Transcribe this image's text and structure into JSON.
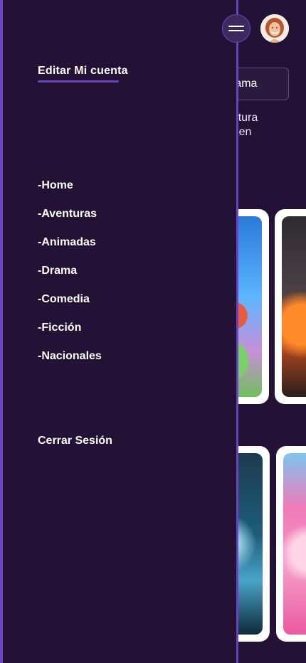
{
  "drawer": {
    "account_label": "Editar Mi cuenta",
    "menu": [
      {
        "label": "-Home"
      },
      {
        "label": "-Aventuras"
      },
      {
        "label": "-Animadas"
      },
      {
        "label": "-Drama"
      },
      {
        "label": "-Comedia"
      },
      {
        "label": "-Ficción"
      },
      {
        "label": "-Nacionales"
      }
    ],
    "logout_label": "Cerrar Sesión"
  },
  "header": {
    "menu_icon": "hamburger-icon",
    "avatar_icon": "user-avatar"
  },
  "background": {
    "genre_button_label": "rama",
    "description_lines": [
      "aventura",
      "ares en"
    ]
  },
  "colors": {
    "background": "#231235",
    "accent": "#6a42c2",
    "text": "#ffffff"
  }
}
